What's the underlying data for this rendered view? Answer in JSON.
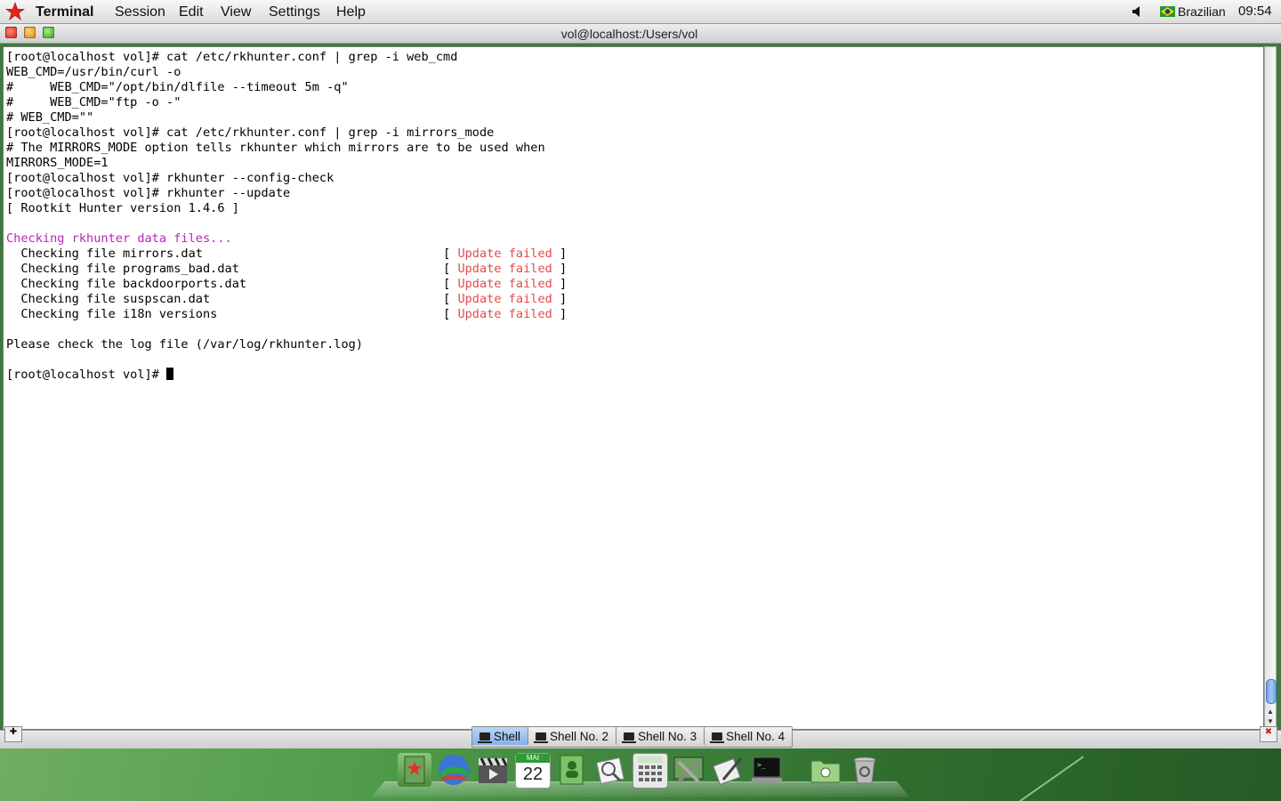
{
  "menubar": {
    "app_name": "Terminal",
    "menus": [
      "Session",
      "Edit",
      "View",
      "Settings",
      "Help"
    ],
    "keyboard_layout": "Brazilian",
    "clock": "09:54"
  },
  "window": {
    "title": "vol@localhost:/Users/vol"
  },
  "terminal": {
    "lines": [
      "[root@localhost vol]# cat /etc/rkhunter.conf | grep -i web_cmd",
      "WEB_CMD=/usr/bin/curl -o",
      "#     WEB_CMD=\"/opt/bin/dlfile --timeout 5m -q\"",
      "#     WEB_CMD=\"ftp -o -\"",
      "# WEB_CMD=\"\"",
      "[root@localhost vol]# cat /etc/rkhunter.conf | grep -i mirrors_mode",
      "# The MIRRORS_MODE option tells rkhunter which mirrors are to be used when",
      "MIRRORS_MODE=1",
      "[root@localhost vol]# rkhunter --config-check",
      "[root@localhost vol]# rkhunter --update",
      "[ Rootkit Hunter version 1.4.6 ]",
      ""
    ],
    "checking_header": "Checking rkhunter data files...",
    "checks": [
      {
        "label": "  Checking file mirrors.dat                                 ",
        "status": "Update failed"
      },
      {
        "label": "  Checking file programs_bad.dat                            ",
        "status": "Update failed"
      },
      {
        "label": "  Checking file backdoorports.dat                           ",
        "status": "Update failed"
      },
      {
        "label": "  Checking file suspscan.dat                                ",
        "status": "Update failed"
      },
      {
        "label": "  Checking file i18n versions                               ",
        "status": "Update failed"
      }
    ],
    "log_message": "Please check the log file (/var/log/rkhunter.log)",
    "prompt": "[root@localhost vol]# "
  },
  "tabs": [
    {
      "label": "Shell",
      "active": true
    },
    {
      "label": "Shell No. 2",
      "active": false
    },
    {
      "label": "Shell No. 3",
      "active": false
    },
    {
      "label": "Shell No. 4",
      "active": false
    }
  ],
  "dock": {
    "calendar_month": "MAI",
    "calendar_day": "22",
    "items": [
      "address-book-icon",
      "browser-globe-icon",
      "video-clapper-icon",
      "calendar-icon",
      "contacts-icon",
      "preview-icon",
      "calculator-icon",
      "system-settings-icon",
      "text-editor-icon",
      "terminal-icon",
      "documents-folder-icon",
      "trash-icon"
    ]
  },
  "colors": {
    "header_magenta": "#b726b7",
    "failed_red": "#e44a4a",
    "active_tab": "#9cc0ef"
  }
}
